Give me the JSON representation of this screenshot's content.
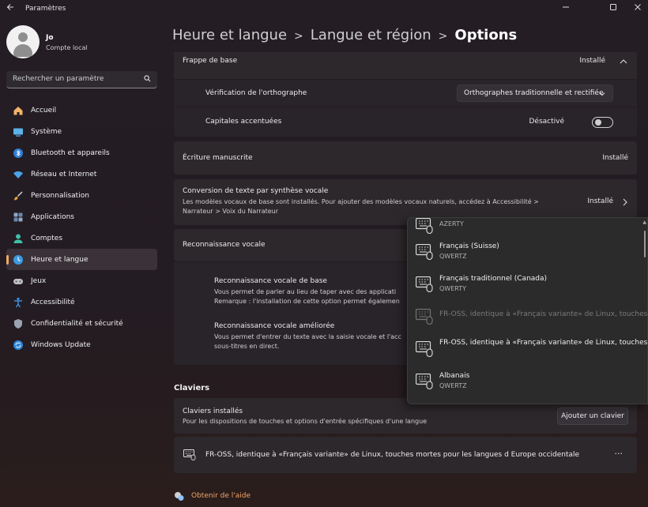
{
  "window": {
    "title": "Paramètres"
  },
  "user": {
    "name": "Jo",
    "account_type": "Compte local"
  },
  "search": {
    "placeholder": "Rechercher un paramètre"
  },
  "sidebar": {
    "items": [
      {
        "label": "Accueil",
        "icon": "home-icon",
        "active": false
      },
      {
        "label": "Système",
        "icon": "system-icon",
        "active": false
      },
      {
        "label": "Bluetooth et appareils",
        "icon": "bluetooth-icon",
        "active": false
      },
      {
        "label": "Réseau et Internet",
        "icon": "wifi-icon",
        "active": false
      },
      {
        "label": "Personnalisation",
        "icon": "brush-icon",
        "active": false
      },
      {
        "label": "Applications",
        "icon": "apps-icon",
        "active": false
      },
      {
        "label": "Comptes",
        "icon": "accounts-icon",
        "active": false
      },
      {
        "label": "Heure et langue",
        "icon": "time-language-icon",
        "active": true
      },
      {
        "label": "Jeux",
        "icon": "gamepad-icon",
        "active": false
      },
      {
        "label": "Accessibilité",
        "icon": "accessibility-icon",
        "active": false
      },
      {
        "label": "Confidentialité et sécurité",
        "icon": "shield-icon",
        "active": false
      },
      {
        "label": "Windows Update",
        "icon": "update-icon",
        "active": false
      }
    ]
  },
  "breadcrumb": {
    "level1": "Heure et langue",
    "level2": "Langue et région",
    "current": "Options"
  },
  "basic_typing": {
    "title": "Frappe de base",
    "status": "Installé",
    "spellcheck_label": "Vérification de l'orthographe",
    "spellcheck_value": "Orthographes traditionnelle et rectifiée",
    "capitals_label": "Capitales accentuées",
    "capitals_state": "Désactivé"
  },
  "handwriting": {
    "title": "Écriture manuscrite",
    "status": "Installé"
  },
  "tts": {
    "title": "Conversion de texte par synthèse vocale",
    "desc_line1": "Les modèles vocaux de base sont installés. Pour ajouter des modèles vocaux naturels, accédez à Accessibilité >",
    "desc_line2": "Narrateur > Voix du Narrateur",
    "status": "Installé"
  },
  "speech": {
    "title": "Reconnaissance vocale",
    "basic_title": "Reconnaissance vocale de base",
    "basic_line1": "Vous permet de parler au lieu de taper avec des applicati",
    "basic_line2": "Remarque : l'installation de cette option permet égalemen",
    "enhanced_title": "Reconnaissance vocale améliorée",
    "enhanced_line1": "Vous permet d'entrer du texte avec la saisie vocale et l'acc",
    "enhanced_line2": "sous-titres en direct."
  },
  "keyboards": {
    "section_title": "Claviers",
    "installed_title": "Claviers installés",
    "installed_desc": "Pour les dispositions de touches et options d'entrée spécifiques d'une langue",
    "add_button": "Ajouter un clavier",
    "layout_name": "FR-OSS, identique à «Français variante» de Linux, touches mortes pour les langues d Europe occidentale",
    "more_label": "···"
  },
  "help": {
    "label": "Obtenir de l'aide"
  },
  "flyout": {
    "items": [
      {
        "name": "",
        "sub": "AZERTY",
        "disabled": false
      },
      {
        "name": "Français (Suisse)",
        "sub": "QWERTZ",
        "disabled": false
      },
      {
        "name": "Français traditionnel (Canada)",
        "sub": "QWERTY",
        "disabled": false
      },
      {
        "name": "FR-OSS, identique à «Français variante» de Linux, touches...",
        "sub": "",
        "disabled": true
      },
      {
        "name": "FR-OSS, identique à «Français variante» de Linux, touches...",
        "sub": "",
        "disabled": false
      },
      {
        "name": "Albanais",
        "sub": "QWERTZ",
        "disabled": false
      }
    ]
  },
  "colors": {
    "accent": "#f0a56a",
    "card": "#2d282c",
    "background": "#241d24"
  }
}
